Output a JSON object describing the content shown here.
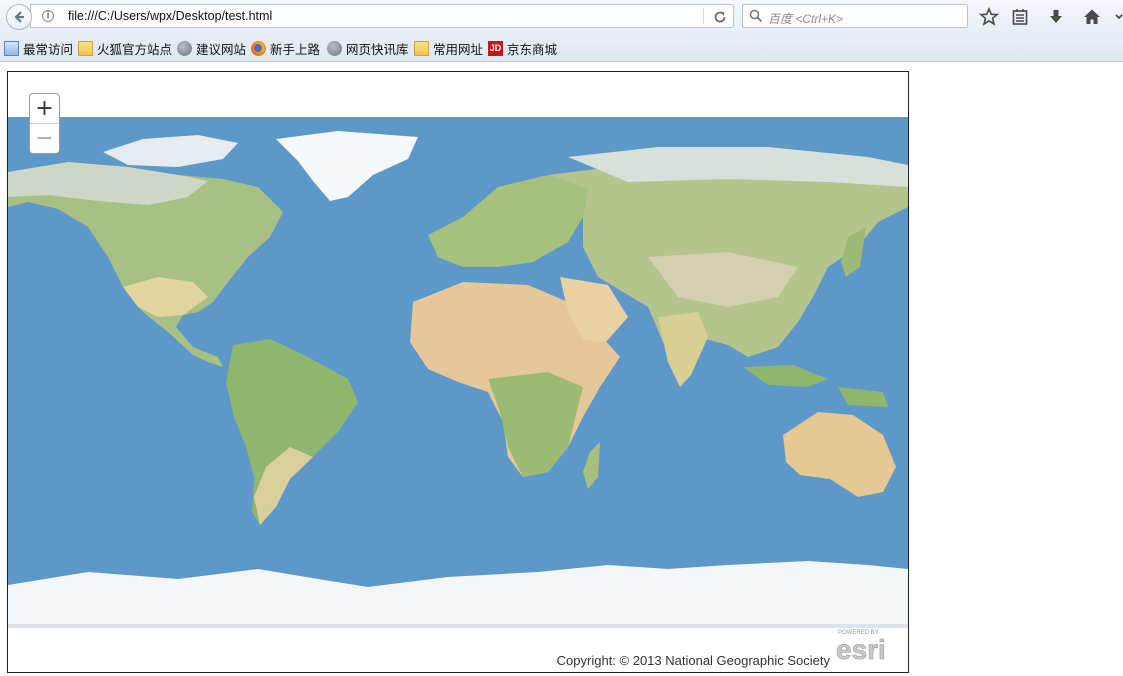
{
  "toolbar": {
    "url": "file:///C:/Users/wpx/Desktop/test.html",
    "search_placeholder": "百度 <Ctrl+K>",
    "icons": [
      "back-icon",
      "info-icon",
      "reload-icon",
      "search-icon",
      "star-icon",
      "reading-list-icon",
      "download-icon",
      "home-icon"
    ]
  },
  "bookmarks": [
    {
      "label": "最常访问",
      "icon": "most-visited-icon"
    },
    {
      "label": "火狐官方站点",
      "icon": "folder-icon"
    },
    {
      "label": "建议网站",
      "icon": "globe-icon"
    },
    {
      "label": "新手上路",
      "icon": "firefox-icon"
    },
    {
      "label": "网页快讯库",
      "icon": "globe-icon"
    },
    {
      "label": "常用网址",
      "icon": "folder-icon"
    },
    {
      "label": "京东商城",
      "icon": "jd-icon"
    }
  ],
  "map": {
    "zoom_in": "+",
    "zoom_out": "−",
    "copyright": "Copyright: © 2013 National Geographic Society",
    "powered_by": "POWERED BY",
    "brand": "esri",
    "colors": {
      "ocean": "#5e98c8",
      "land": "#e4dca8",
      "vegetation": "#9bbb7c",
      "ice": "#f5f7fa",
      "desert": "#e8c9a2"
    }
  }
}
